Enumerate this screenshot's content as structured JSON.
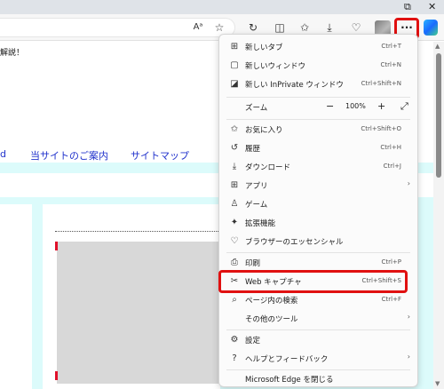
{
  "toolbar": {
    "icons": [
      "read-aloud-icon",
      "favorite-star-icon",
      "refresh-icon",
      "split-screen-icon",
      "favorites-icon",
      "downloads-icon",
      "extensions-icon",
      "profile-avatar",
      "more-icon",
      "copilot-icon"
    ],
    "read_aloud_glyph": "Aᵃ",
    "favorite_glyph": "☆",
    "refresh_glyph": "↻",
    "split_glyph": "◫",
    "favorites_glyph": "✩",
    "download_glyph": "⤓",
    "extensions_glyph": "♡",
    "more_glyph": "···",
    "window_restore_glyph": "⧉",
    "window_close_glyph": "✕"
  },
  "page": {
    "header_text": "解説！",
    "nav_links": [
      "d",
      "当サイトのご案内",
      "サイトマップ"
    ]
  },
  "menu": {
    "items": [
      {
        "label": "新しいタブ",
        "shortcut": "Ctrl+T",
        "icon": "new-tab-icon",
        "glyph": "⊞"
      },
      {
        "label": "新しいウィンドウ",
        "shortcut": "Ctrl+N",
        "icon": "new-window-icon",
        "glyph": "▢"
      },
      {
        "label": "新しい InPrivate ウィンドウ",
        "shortcut": "Ctrl+Shift+N",
        "icon": "inprivate-icon",
        "glyph": "◪"
      },
      {
        "label": "お気に入り",
        "shortcut": "Ctrl+Shift+O",
        "icon": "favorites-icon",
        "glyph": "✩"
      },
      {
        "label": "履歴",
        "shortcut": "Ctrl+H",
        "icon": "history-icon",
        "glyph": "↺"
      },
      {
        "label": "ダウンロード",
        "shortcut": "Ctrl+J",
        "icon": "download-icon",
        "glyph": "⤓"
      },
      {
        "label": "アプリ",
        "shortcut": "",
        "icon": "apps-icon",
        "glyph": "⊞",
        "submenu": true
      },
      {
        "label": "ゲーム",
        "shortcut": "",
        "icon": "games-icon",
        "glyph": "♙"
      },
      {
        "label": "拡張機能",
        "shortcut": "",
        "icon": "extensions-icon",
        "glyph": "✦"
      },
      {
        "label": "ブラウザーのエッセンシャル",
        "shortcut": "",
        "icon": "essentials-icon",
        "glyph": "♡"
      },
      {
        "label": "印刷",
        "shortcut": "Ctrl+P",
        "icon": "print-icon",
        "glyph": "⎙"
      },
      {
        "label": "Web キャプチャ",
        "shortcut": "Ctrl+Shift+S",
        "icon": "web-capture-icon",
        "glyph": "✂"
      },
      {
        "label": "ページ内の検索",
        "shortcut": "Ctrl+F",
        "icon": "find-icon",
        "glyph": "⌕"
      },
      {
        "label": "その他のツール",
        "shortcut": "",
        "icon": "",
        "glyph": "",
        "submenu": true
      },
      {
        "label": "設定",
        "shortcut": "",
        "icon": "settings-icon",
        "glyph": "⚙"
      },
      {
        "label": "ヘルプとフィードバック",
        "shortcut": "",
        "icon": "help-icon",
        "glyph": "?",
        "submenu": true
      },
      {
        "label": "Microsoft Edge を閉じる",
        "shortcut": "",
        "icon": "",
        "glyph": ""
      }
    ],
    "zoom": {
      "label": "ズーム",
      "value": "100%",
      "minus": "−",
      "plus": "+",
      "fullscreen": "⤢",
      "icon": "zoom-icon"
    },
    "submenu_arrow": "›"
  },
  "colors": {
    "highlight": "#e01010",
    "link": "#2233cc",
    "cyan": "#dcfbfb"
  }
}
